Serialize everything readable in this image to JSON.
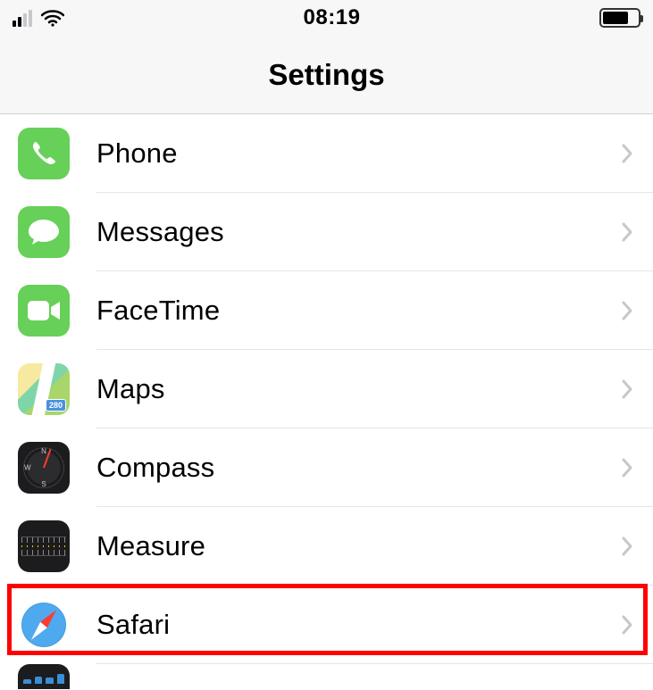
{
  "status": {
    "time": "08:19"
  },
  "header": {
    "title": "Settings"
  },
  "rows": [
    {
      "label": "Phone"
    },
    {
      "label": "Messages"
    },
    {
      "label": "FaceTime"
    },
    {
      "label": "Maps"
    },
    {
      "label": "Compass"
    },
    {
      "label": "Measure"
    },
    {
      "label": "Safari"
    }
  ]
}
